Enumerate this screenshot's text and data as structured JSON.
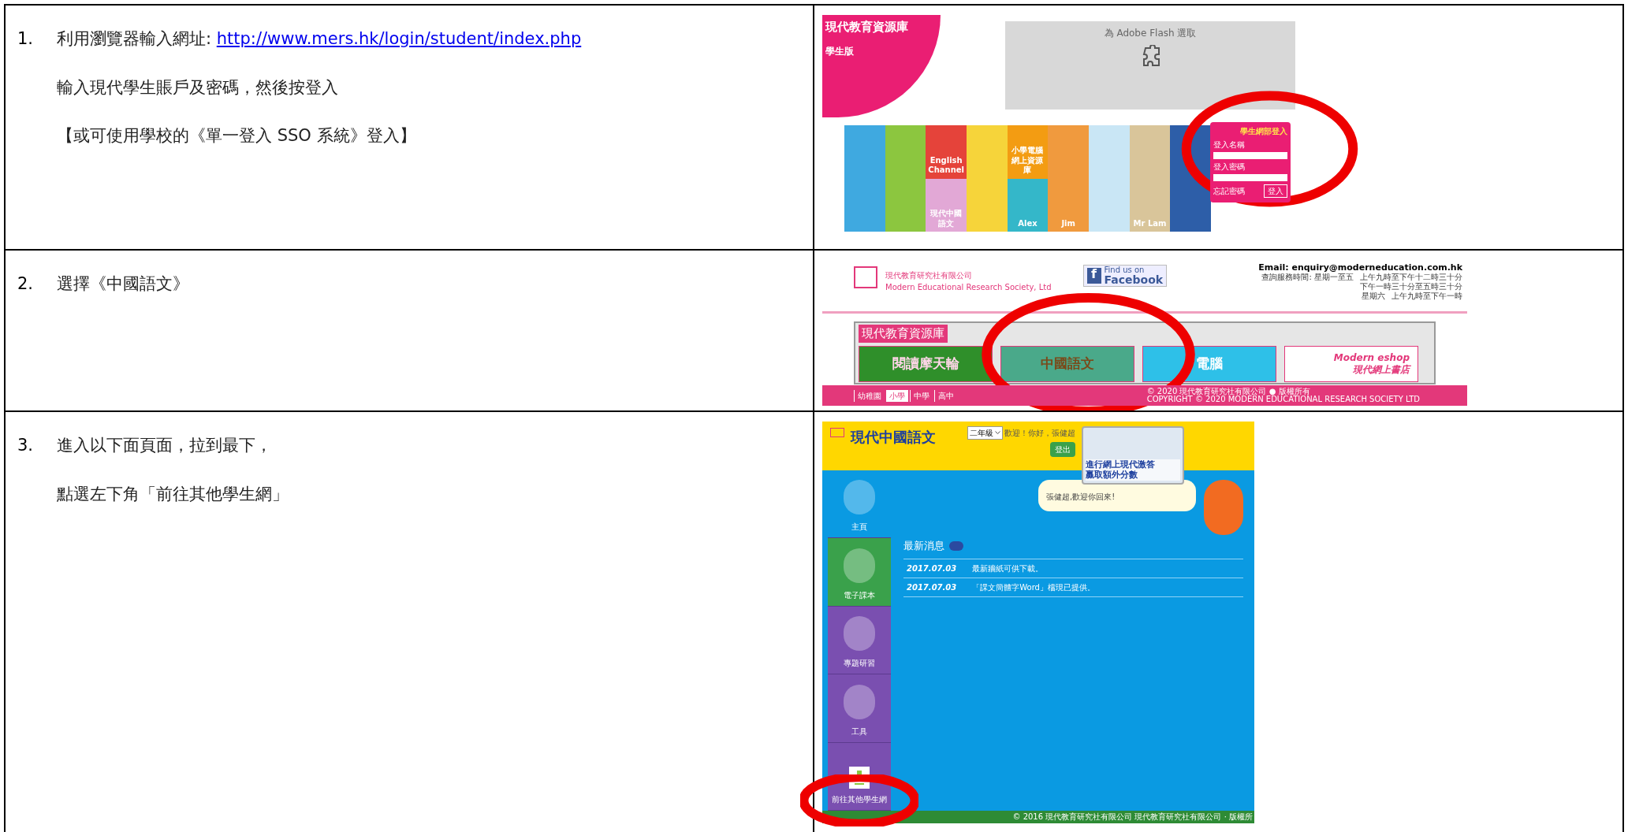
{
  "steps": [
    {
      "number": "1.",
      "lines": [
        {
          "text": "利用瀏覽器輸入網址: ",
          "link": "http://www.mers.hk/login/student/index.php"
        },
        {
          "text": "輸入現代學生賬戶及密碼，然後按登入"
        },
        {
          "text": "【或可使用學校的《單一登入 SSO 系統》登入】"
        }
      ],
      "screenshot": {
        "kind": "login",
        "brand": "現代教育資源庫",
        "edition": "學生版",
        "plugin_prompt": "為 Adobe Flash 選取",
        "login_title": "學生網部登入",
        "username_label": "登入名稱",
        "password_label": "登入密碼",
        "forgot": "忘記密碼",
        "login_button": "登入",
        "tiles": [
          "English Channel",
          "小學電腦網上資源庫",
          "現代中國語文",
          "Alex",
          "Jim",
          "Mr Lam"
        ]
      }
    },
    {
      "number": "2.",
      "lines": [
        {
          "text": "選擇《中國語文》"
        }
      ],
      "screenshot": {
        "kind": "portal",
        "company": "現代教育研究社有限公司",
        "company_en": "Modern Educational Research Society, Ltd",
        "facebook_icon": "f",
        "facebook_small": "Find us on",
        "facebook": "Facebook",
        "email": "Email:  enquiry@moderneducation.com.hk",
        "hours": [
          {
            "label": "查詢服務時間:  星期一至五",
            "times": [
              "上午九時至下午十二時三十分",
              "下午一時三十分至五時三十分"
            ]
          },
          {
            "label": "星期六",
            "times": [
              "上午九時至下午一時"
            ]
          }
        ],
        "banner": "現代教育資源庫",
        "products": [
          "閱讀摩天輪",
          "中國語文",
          "電腦"
        ],
        "eshop": "Modern eshop",
        "eshop_sub": "現代網上書店",
        "levels": [
          {
            "label": "幼稚園",
            "selected": false
          },
          {
            "label": "小學",
            "selected": true
          },
          {
            "label": "中學",
            "selected": false
          },
          {
            "label": "高中",
            "selected": false
          }
        ],
        "copyright": "© 2020 現代教育研究社有限公司 ● 版權所有",
        "copyright_en": "COPYRIGHT © 2020 MODERN EDUCATIONAL RESEARCH SOCIETY LTD"
      }
    },
    {
      "number": "3.",
      "lines": [
        {
          "text": "進入以下面頁面，拉到最下，"
        },
        {
          "text": "點選左下角「前往其他學生網」"
        }
      ],
      "screenshot": {
        "kind": "course",
        "logo": "現代中國語文",
        "grade": "二年級",
        "greeting": "歡迎！你好，張健超",
        "logout": "登出",
        "ad": [
          "進行網上現代激答",
          "贏取額外分數"
        ],
        "bubble": "張健超,歡迎你回來!",
        "nav": [
          {
            "label": "主頁",
            "selected": false
          },
          {
            "label": "電子課本",
            "selected": true
          },
          {
            "label": "專題研習",
            "selected": false
          },
          {
            "label": "工具",
            "selected": false
          },
          {
            "label": "前往其他學生網",
            "selected": false
          }
        ],
        "news_title": "最新消息",
        "news": [
          {
            "date": "2017.07.03",
            "text": "最新牆紙可供下載。"
          },
          {
            "date": "2017.07.03",
            "text": "「課文簡體字Word」檔現已提供。"
          }
        ],
        "footer": "© 2016 現代教育研究社有限公司  現代教育研究社有限公司 · 版權所"
      }
    }
  ]
}
